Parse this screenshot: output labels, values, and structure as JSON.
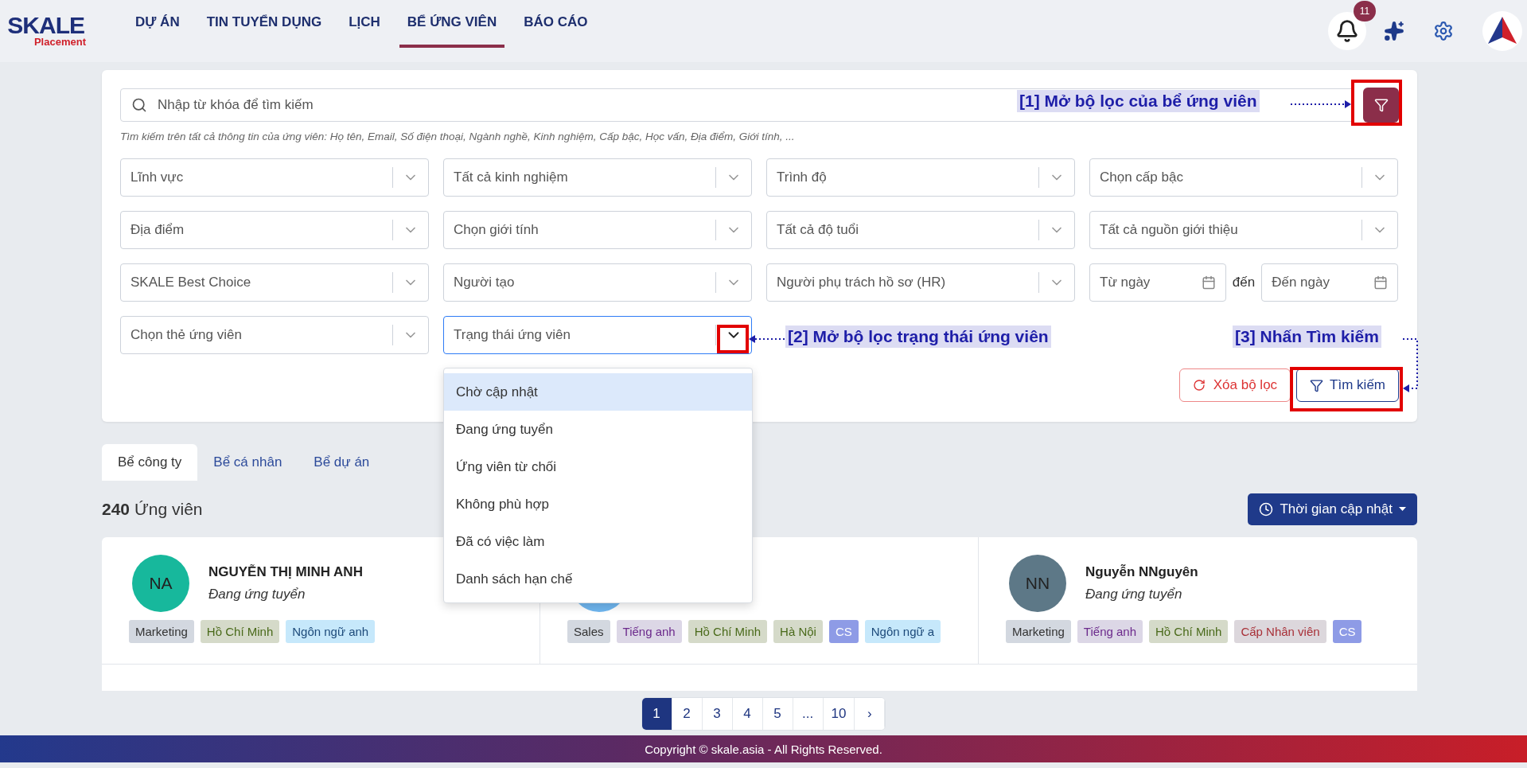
{
  "header": {
    "logo": {
      "name": "SKALE",
      "sub": "Placement"
    },
    "nav": [
      {
        "label": "DỰ ÁN",
        "selected": false
      },
      {
        "label": "TIN TUYỂN DỤNG",
        "selected": false
      },
      {
        "label": "LỊCH",
        "selected": false
      },
      {
        "label": "BỂ ỨNG VIÊN",
        "selected": true
      },
      {
        "label": "BÁO CÁO",
        "selected": false
      }
    ],
    "notifications": "11"
  },
  "search": {
    "placeholder": "Nhập từ khóa để tìm kiếm",
    "hint": "Tìm kiếm trên tất cả thông tin của ứng viên: Họ tên, Email, Số điện thoại, Ngành nghề, Kinh nghiệm, Cấp bậc, Học vấn, Địa điểm, Giới tính, ..."
  },
  "filters": [
    {
      "kind": "select",
      "placeholder": "Lĩnh vực",
      "expanded": false
    },
    {
      "kind": "select",
      "placeholder": "Tất cả kinh nghiệm",
      "expanded": false
    },
    {
      "kind": "select",
      "placeholder": "Trình độ",
      "expanded": false
    },
    {
      "kind": "select",
      "placeholder": "Chọn cấp bậc",
      "expanded": false
    },
    {
      "kind": "select",
      "placeholder": "Địa điểm",
      "expanded": false
    },
    {
      "kind": "select",
      "placeholder": "Chọn giới tính",
      "expanded": false
    },
    {
      "kind": "select",
      "placeholder": "Tất cả độ tuổi",
      "expanded": false
    },
    {
      "kind": "select",
      "placeholder": "Tất cả nguồn giới thiệu",
      "expanded": false
    },
    {
      "kind": "select",
      "placeholder": "SKALE Best Choice",
      "expanded": false
    },
    {
      "kind": "select",
      "placeholder": "Người tạo",
      "expanded": false
    },
    {
      "kind": "select",
      "placeholder": "Người phụ trách hồ sơ (HR)",
      "expanded": false
    },
    {
      "kind": "daterange",
      "from": "Từ ngày",
      "separator": "đến",
      "to": "Đến ngày"
    },
    {
      "kind": "select",
      "placeholder": "Chọn thẻ ứng viên",
      "expanded": false
    },
    {
      "kind": "select",
      "placeholder": "Trạng thái ứng viên",
      "expanded": true
    }
  ],
  "status_menu": [
    {
      "label": "Chờ cập nhật",
      "selected": true
    },
    {
      "label": "Đang ứng tuyển",
      "selected": false
    },
    {
      "label": "Ứng viên từ chối",
      "selected": false
    },
    {
      "label": "Không phù hợp",
      "selected": false
    },
    {
      "label": "Đã có việc làm",
      "selected": false
    },
    {
      "label": "Danh sách hạn chế",
      "selected": false
    }
  ],
  "buttons": {
    "clear": "Xóa bộ lọc",
    "search": "Tìm kiếm"
  },
  "annotations": [
    {
      "text": "[1] Mở bộ lọc của bể ứng viên"
    },
    {
      "text": "[2] Mở bộ lọc trạng thái ứng viên"
    },
    {
      "text": "[3] Nhấn Tìm kiếm"
    }
  ],
  "pool_tabs": [
    {
      "label": "Bể công ty",
      "selected": true
    },
    {
      "label": "Bể cá nhân",
      "selected": false
    },
    {
      "label": "Bể dự án",
      "selected": false
    }
  ],
  "count": {
    "number": "240",
    "label": "Ứng viên"
  },
  "sort": {
    "label": "Thời gian cập nhật"
  },
  "candidates": [
    {
      "initials": "NA",
      "color": "#17b89c",
      "name": "NGUYỄN THỊ MINH ANH",
      "status": "Đang ứng tuyển",
      "tags": [
        {
          "label": "Marketing",
          "kind": "field"
        },
        {
          "label": "Hồ Chí Minh",
          "kind": "place"
        },
        {
          "label": "Ngôn ngữ anh",
          "kind": "skill"
        }
      ]
    },
    {
      "color": "#6fb6ef",
      "tags": [
        {
          "label": "Sales",
          "kind": "field"
        },
        {
          "label": "Tiếng anh",
          "kind": "language"
        },
        {
          "label": "Hồ Chí Minh",
          "kind": "place"
        },
        {
          "label": "Hà Nội",
          "kind": "place"
        },
        {
          "label": "CS",
          "kind": "note"
        },
        {
          "label": "Ngôn ngữ a",
          "kind": "skill"
        }
      ]
    },
    {
      "initials": "NN",
      "color": "#5d7887",
      "name": "Nguyễn NNguyên",
      "status": "Đang ứng tuyển",
      "tags": [
        {
          "label": "Marketing",
          "kind": "field"
        },
        {
          "label": "Tiếng anh",
          "kind": "language"
        },
        {
          "label": "Hồ Chí Minh",
          "kind": "place"
        },
        {
          "label": "Cấp Nhân viên",
          "kind": "level"
        },
        {
          "label": "CS",
          "kind": "note"
        }
      ]
    }
  ],
  "pagination": [
    {
      "label": "1",
      "selected": true
    },
    {
      "label": "2",
      "selected": false
    },
    {
      "label": "3",
      "selected": false
    },
    {
      "label": "4",
      "selected": false
    },
    {
      "label": "5",
      "selected": false
    },
    {
      "label": "...",
      "selected": false
    },
    {
      "label": "10",
      "selected": false
    },
    {
      "label": "›",
      "selected": false
    }
  ],
  "footer": "Copyright © skale.asia - All Rights Reserved."
}
